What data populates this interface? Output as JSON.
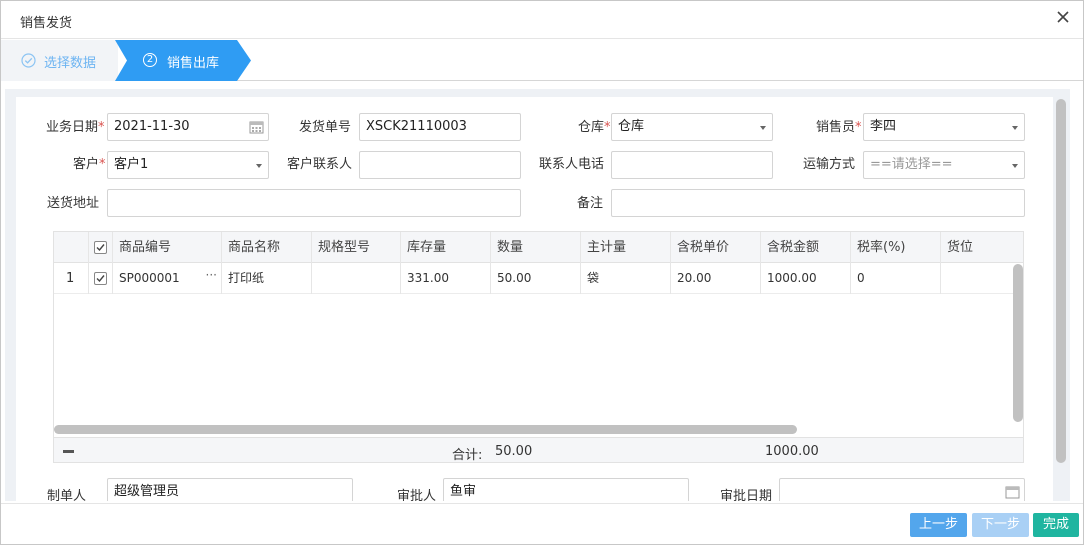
{
  "dialog": {
    "title": "销售发货"
  },
  "steps": [
    {
      "label": "选择数据",
      "state": "done"
    },
    {
      "number": "2",
      "label": "销售出库",
      "state": "active"
    }
  ],
  "form": {
    "biz_date": {
      "label": "业务日期",
      "req": "*",
      "value": "2021-11-30"
    },
    "ship_no": {
      "label": "发货单号",
      "value": "XSCK21110003"
    },
    "warehouse": {
      "label": "仓库",
      "req": "*",
      "value": "仓库"
    },
    "salesperson": {
      "label": "销售员",
      "req": "*",
      "value": "李四"
    },
    "customer": {
      "label": "客户",
      "req": "*",
      "value": "客户1"
    },
    "contact": {
      "label": "客户联系人",
      "value": ""
    },
    "phone": {
      "label": "联系人电话",
      "value": ""
    },
    "transport": {
      "label": "运输方式",
      "placeholder": "==请选择=="
    },
    "address": {
      "label": "送货地址",
      "value": ""
    },
    "remark": {
      "label": "备注",
      "value": ""
    }
  },
  "grid": {
    "columns": [
      "商品编号",
      "商品名称",
      "规格型号",
      "库存量",
      "数量",
      "主计量",
      "含税单价",
      "含税金额",
      "税率(%)",
      "货位"
    ],
    "rows": [
      {
        "index": "1",
        "code": "SP000001",
        "more": "···",
        "name": "打印纸",
        "spec": "",
        "stock": "331.00",
        "qty": "50.00",
        "unit": "袋",
        "price": "20.00",
        "amount": "1000.00",
        "tax": "0",
        "loc": ""
      }
    ],
    "footer": {
      "total_label": "合计:",
      "total_qty": "50.00",
      "total_amount": "1000.00"
    }
  },
  "lower_form": {
    "maker": {
      "label": "制单人",
      "value": "超级管理员"
    },
    "approver": {
      "label": "审批人",
      "value": "鱼审"
    },
    "approve_date": {
      "label": "审批日期",
      "value": ""
    }
  },
  "buttons": {
    "prev": "上一步",
    "next": "下一步",
    "finish": "完成"
  },
  "colors": {
    "accent": "#53a6ec",
    "step_active": "#2f9cf3",
    "finish": "#1fb5a0",
    "required": "#d9534f"
  }
}
